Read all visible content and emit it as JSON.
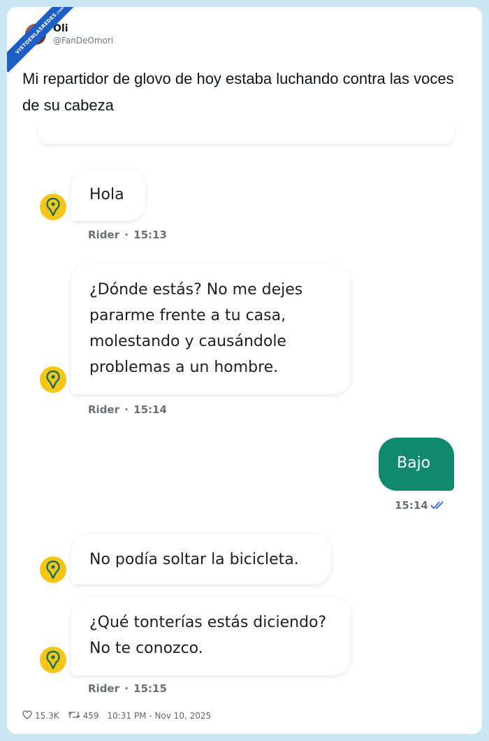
{
  "watermark": {
    "text": "VISTOENLASREDES",
    "domain": ".com"
  },
  "author": {
    "name": "Oli",
    "handle": "@FanDeOmori"
  },
  "tweet": {
    "text": "Mi repartidor de glovo de hoy estaba luchando contra las voces de su cabeza"
  },
  "chat": {
    "messages": [
      {
        "direction": "in",
        "text": "Hola",
        "meta_sender": "Rider",
        "meta_time": "15:13"
      },
      {
        "direction": "in",
        "text": "¿Dónde estás? No me dejes pararme frente a tu casa, molestando y causándole problemas a un hombre.",
        "meta_sender": "Rider",
        "meta_time": "15:14"
      },
      {
        "direction": "out",
        "text": "Bajo",
        "meta_time": "15:14"
      },
      {
        "direction": "in",
        "text": "No podía soltar la bicicleta."
      },
      {
        "direction": "in",
        "text": "¿Qué tonterías estás diciendo? No te conozco.",
        "meta_sender": "Rider",
        "meta_time": "15:15"
      }
    ],
    "meta_separator": "·",
    "colors": {
      "outgoing_bubble": "#0f8a6f",
      "rider_icon": "#f5c518",
      "read_checks": "#3b6fd9"
    },
    "icons": {
      "rider": "rider-pin-icon",
      "read": "double-check-icon"
    }
  },
  "footer": {
    "likes": "15.3K",
    "retweets": "459",
    "timestamp": "10:31 PM - Nov 10, 2025"
  }
}
